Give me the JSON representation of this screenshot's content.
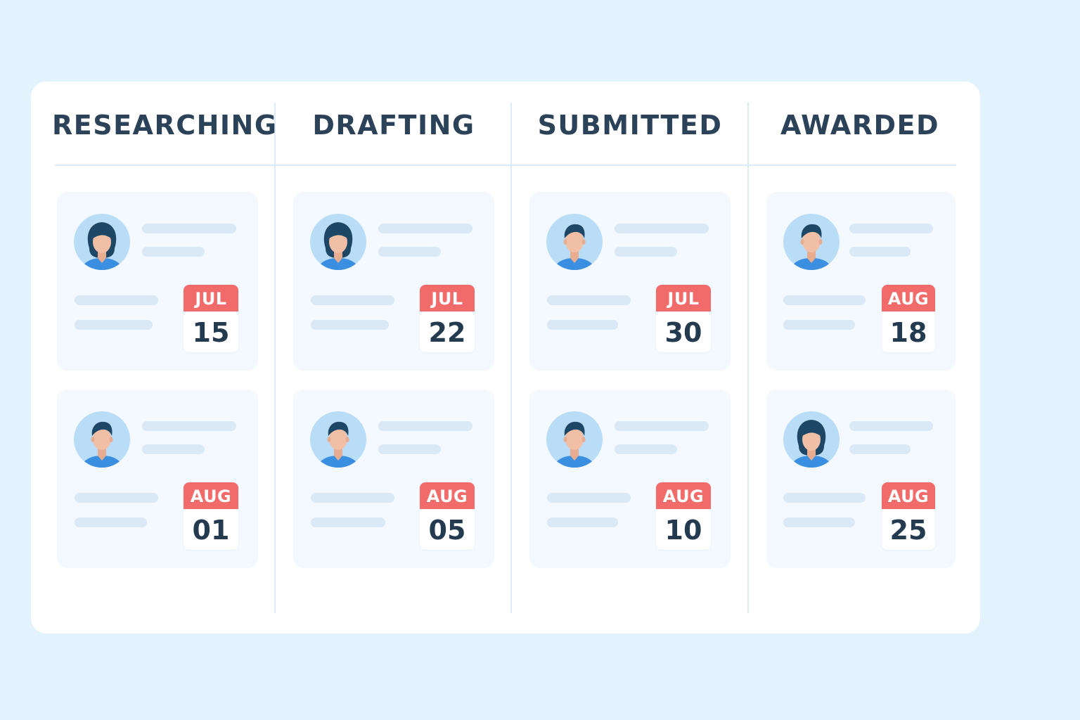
{
  "colors": {
    "background": "#e3f3fd",
    "board": "#ffffff",
    "card": "#f3f9fe",
    "calendar_header": "#f26b6b",
    "title_text": "#2b4258",
    "avatar_circle": "#b9dcf7",
    "avatar_shirt": "#3b8fe0",
    "avatar_hair": "#1e4766",
    "avatar_skin": "#f1bfa5"
  },
  "columns": [
    {
      "title": "RESEARCHING",
      "cards": [
        {
          "avatar": "female-user-icon",
          "month": "JUL",
          "day": "15"
        },
        {
          "avatar": "male-user-icon",
          "month": "AUG",
          "day": "01"
        }
      ]
    },
    {
      "title": "DRAFTING",
      "cards": [
        {
          "avatar": "female-user-icon",
          "month": "JUL",
          "day": "22"
        },
        {
          "avatar": "male-user-icon",
          "month": "AUG",
          "day": "05"
        }
      ]
    },
    {
      "title": "SUBMITTED",
      "cards": [
        {
          "avatar": "male-user-icon",
          "month": "JUL",
          "day": "30"
        },
        {
          "avatar": "male-user-icon",
          "month": "AUG",
          "day": "10"
        }
      ]
    },
    {
      "title": "AWARDED",
      "cards": [
        {
          "avatar": "male-user-icon",
          "month": "AUG",
          "day": "18"
        },
        {
          "avatar": "female-user-icon",
          "month": "AUG",
          "day": "25"
        }
      ]
    }
  ]
}
